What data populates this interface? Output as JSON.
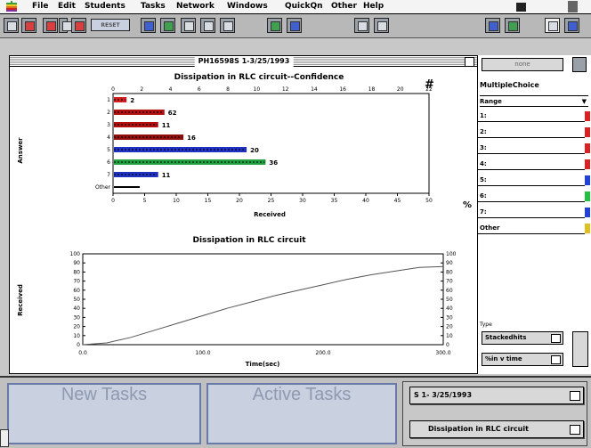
{
  "menubar": {
    "items": [
      "File",
      "Edit",
      "Students",
      "Tasks",
      "Network",
      "Windows",
      "QuickQn",
      "Other",
      "Help"
    ]
  },
  "toolbar": {
    "field_label": "RESET"
  },
  "main_window": {
    "title": "PH16598S 1-3/25/1993"
  },
  "chart_confidence": {
    "title": "Dissipation in RLC circuit--Confidence",
    "hash_label": "#",
    "percent_label": "%",
    "axis_top_ticks": [
      "0",
      "2",
      "4",
      "6",
      "8",
      "10",
      "12",
      "14",
      "16",
      "18",
      "20",
      "22"
    ],
    "axis_bottom_ticks": [
      "0",
      "5",
      "10",
      "15",
      "20",
      "25",
      "30",
      "35",
      "40",
      "45",
      "50"
    ],
    "xlabel": "Received",
    "ylabel": "Answer"
  },
  "chart_dissipation": {
    "title": "Dissipation in RLC circuit",
    "ylabel": "Received",
    "xlabel": "Time(sec)",
    "x_ticks": [
      "0.0",
      "100.0",
      "200.0",
      "300.0"
    ],
    "y_ticks": [
      "0",
      "10",
      "20",
      "30",
      "40",
      "50",
      "60",
      "70",
      "80",
      "90",
      "100"
    ]
  },
  "chart_data": [
    {
      "type": "bar",
      "title": "Dissipation in RLC circuit--Confidence",
      "xlabel": "Received",
      "ylabel": "Answer",
      "categories": [
        "1",
        "2",
        "3",
        "4",
        "5",
        "6",
        "7",
        "Other"
      ],
      "values": [
        2,
        62,
        11,
        16,
        20,
        36,
        11,
        null
      ],
      "bar_values": [
        2,
        8,
        7,
        11,
        21,
        24,
        7,
        0
      ],
      "bar_colors": [
        "#d02020",
        "#b01010",
        "#b01010",
        "#901010",
        "#2030c0",
        "#20a040",
        "#2030c0",
        "#000000"
      ],
      "xlim": [
        0,
        50
      ]
    },
    {
      "type": "line",
      "title": "Dissipation in RLC circuit",
      "xlabel": "Time(sec)",
      "ylabel": "Received",
      "xlim": [
        0,
        300
      ],
      "ylim": [
        0,
        100
      ],
      "x": [
        0,
        20,
        40,
        60,
        80,
        100,
        120,
        140,
        160,
        180,
        200,
        220,
        240,
        260,
        280,
        300
      ],
      "y": [
        0,
        2,
        8,
        16,
        24,
        32,
        40,
        47,
        54,
        60,
        66,
        72,
        77,
        81,
        85,
        86
      ]
    }
  ],
  "right_panel": {
    "top_button": "none",
    "header": "MultipleChoice",
    "dropdown_label": "Range",
    "rows": [
      {
        "label": "1:",
        "color": "#e02020"
      },
      {
        "label": "2:",
        "color": "#e02020"
      },
      {
        "label": "3:",
        "color": "#e02020"
      },
      {
        "label": "4:",
        "color": "#e02020"
      },
      {
        "label": "5:",
        "color": "#2040e0"
      },
      {
        "label": "6:",
        "color": "#20c040"
      },
      {
        "label": "7:",
        "color": "#2040e0"
      },
      {
        "label": "Other",
        "color": "#e0c020"
      }
    ],
    "type_label": "Type",
    "stack_button": "Stackedhits",
    "time_button": "%in v time"
  },
  "bottom": {
    "new_tasks": "New Tasks",
    "active_tasks": "Active Tasks",
    "session_button": "S 1- 3/25/1993",
    "question_button": "Dissipation in RLC circuit"
  }
}
